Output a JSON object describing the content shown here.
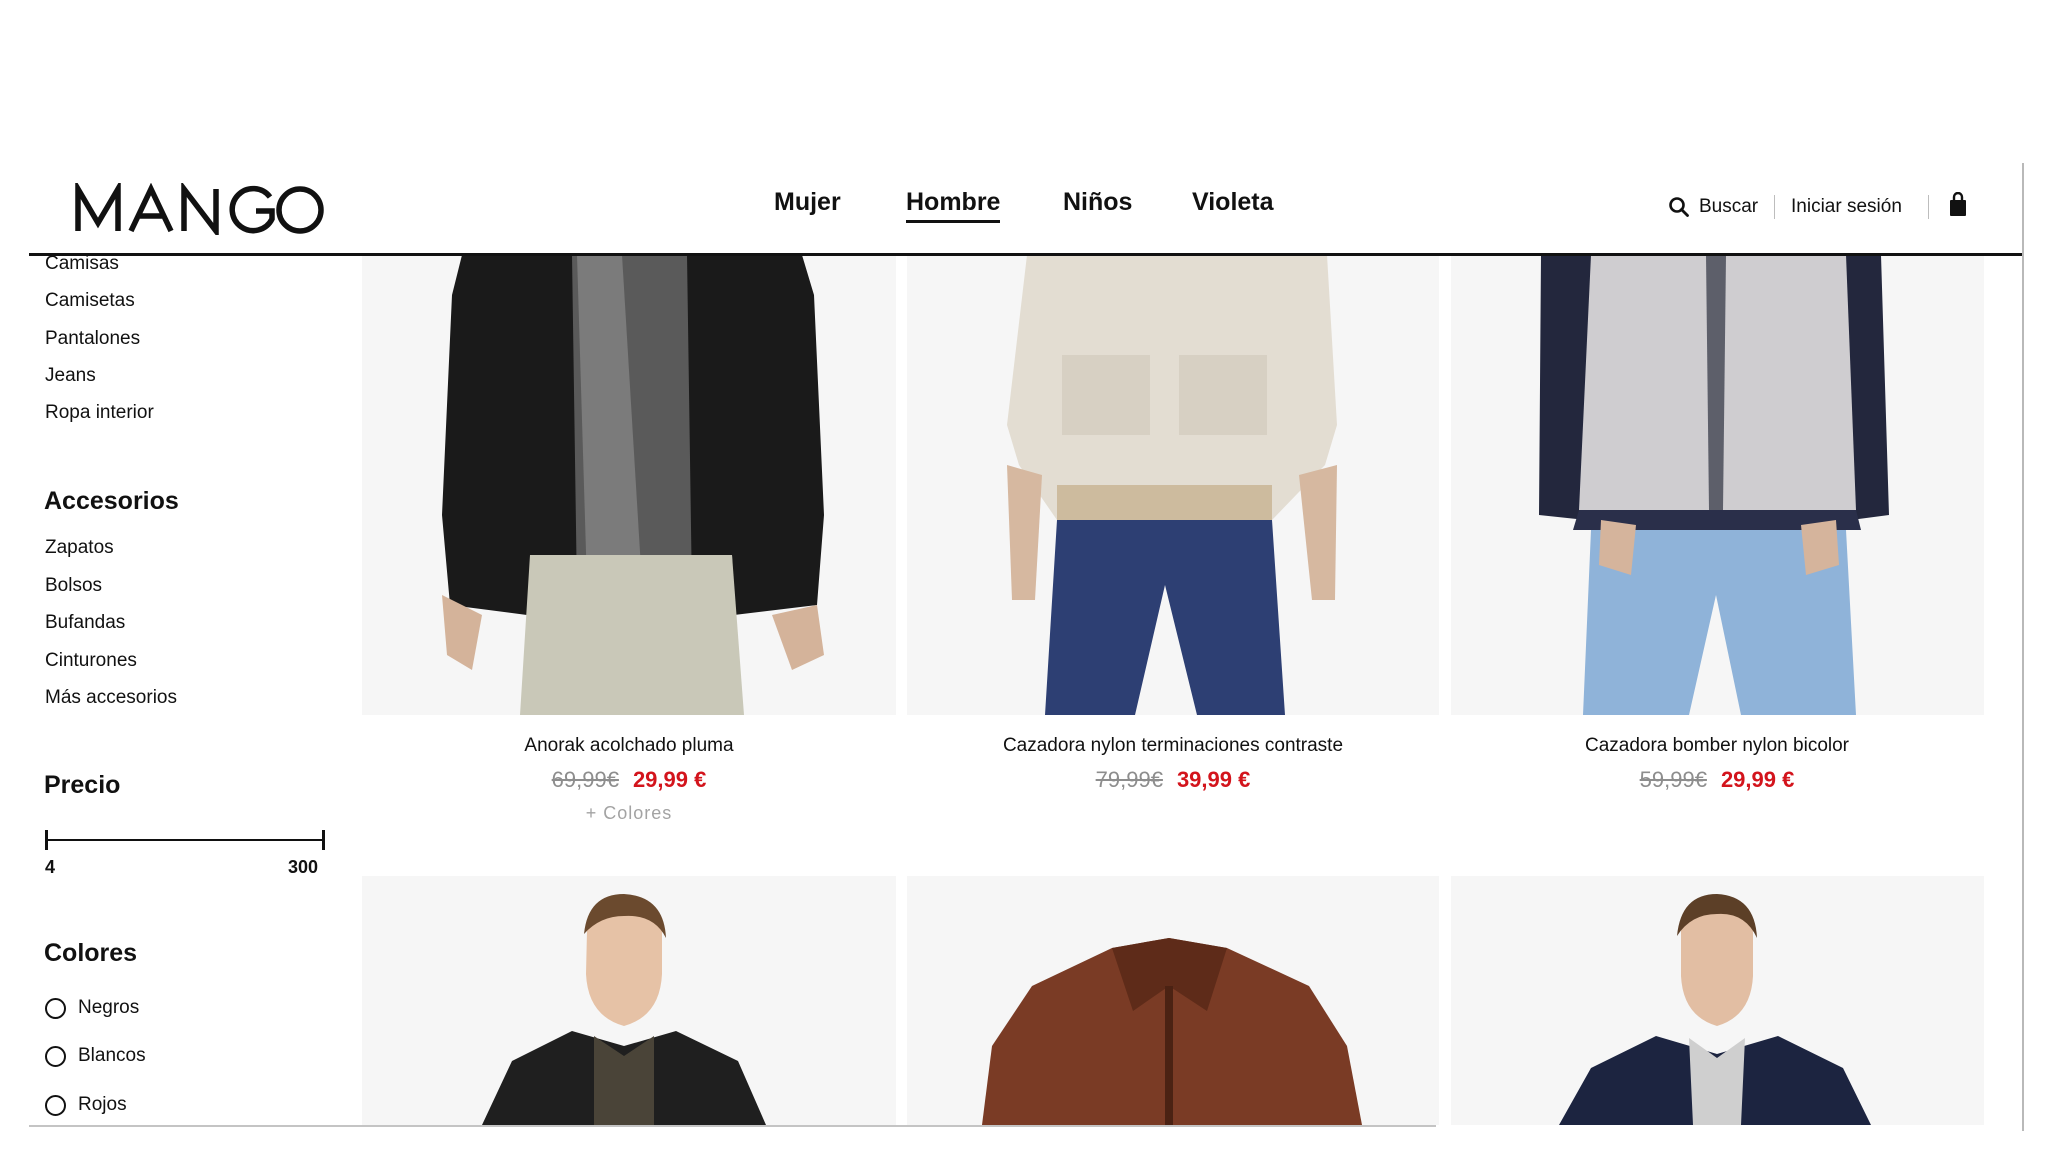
{
  "brand": {
    "logo_text": "MANGO"
  },
  "nav": {
    "items": [
      "Mujer",
      "Hombre",
      "Niños",
      "Violeta"
    ],
    "active": "Hombre"
  },
  "header_utils": {
    "search_label": "Buscar",
    "login_label": "Iniciar sesión",
    "bag_icon": "shopping-bag-icon",
    "search_icon": "search-icon"
  },
  "sidebar": {
    "clothing_links": [
      "Camisas",
      "Camisetas",
      "Pantalones",
      "Jeans",
      "Ropa interior"
    ],
    "accessories": {
      "title": "Accesorios",
      "links": [
        "Zapatos",
        "Bolsos",
        "Bufandas",
        "Cinturones",
        "Más accesorios"
      ]
    },
    "price": {
      "title": "Precio",
      "min_label": "4",
      "max_label": "300",
      "selected_min": 4,
      "selected_max": 300
    },
    "colors": {
      "title": "Colores",
      "options": [
        "Negros",
        "Blancos",
        "Rojos"
      ]
    }
  },
  "products": [
    {
      "name": "Anorak acolchado pluma",
      "old_price": "69,99€",
      "price": "29,99 €",
      "more_colors": "+ Colores"
    },
    {
      "name": "Cazadora nylon terminaciones contraste",
      "old_price": "79,99€",
      "price": "39,99 €",
      "more_colors": ""
    },
    {
      "name": "Cazadora bomber nylon bicolor",
      "old_price": "59,99€",
      "price": "29,99 €",
      "more_colors": ""
    }
  ],
  "colors": {
    "sale": "#d3141c",
    "text": "#111111",
    "muted": "#8d8d8d",
    "tile_bg": "#f6f6f6"
  }
}
